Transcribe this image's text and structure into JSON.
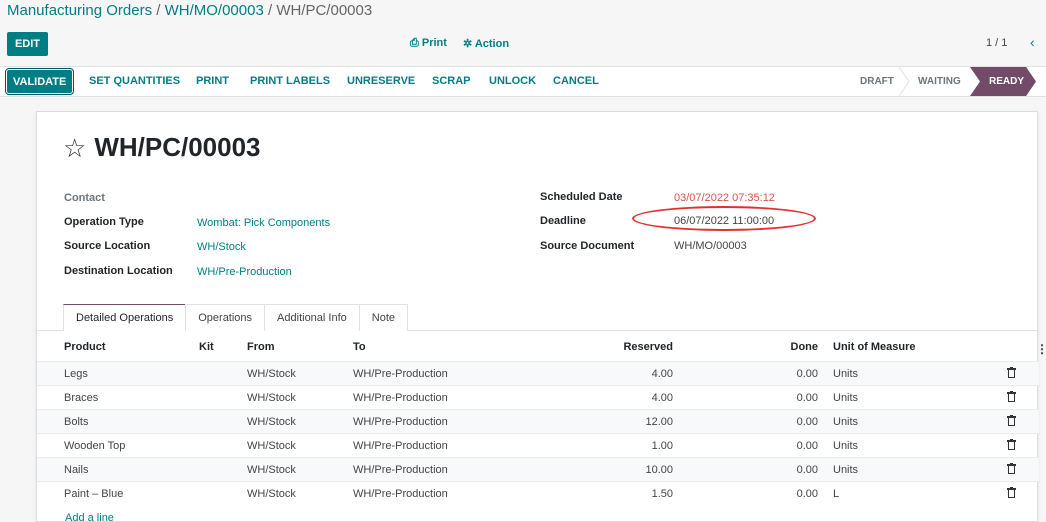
{
  "breadcrumb": {
    "part1": "Manufacturing Orders",
    "sep": " / ",
    "part2": "WH/MO/00003",
    "part3": "WH/PC/00003"
  },
  "control": {
    "edit": "EDIT",
    "print": "Print",
    "action": "Action",
    "pager": "1 / 1",
    "print_icon": "printer-icon",
    "action_icon": "gear-icon"
  },
  "statusbar": {
    "buttons": [
      "VALIDATE",
      "SET QUANTITIES",
      "PRINT",
      "PRINT LABELS",
      "UNRESERVE",
      "SCRAP",
      "UNLOCK",
      "CANCEL"
    ],
    "stages": [
      "DRAFT",
      "WAITING",
      "READY"
    ],
    "active_stage": "READY"
  },
  "record": {
    "title": "WH/PC/00003",
    "left_fields": [
      {
        "label": "Contact",
        "value": ""
      },
      {
        "label": "Operation Type",
        "value": "Wombat: Pick Components"
      },
      {
        "label": "Source Location",
        "value": "WH/Stock"
      },
      {
        "label": "Destination Location",
        "value": "WH/Pre-Production"
      }
    ],
    "right_fields": [
      {
        "label": "Scheduled Date",
        "value": "03/07/2022 07:35:12"
      },
      {
        "label": "Deadline",
        "value": "06/07/2022 11:00:00"
      },
      {
        "label": "Source Document",
        "value": "WH/MO/00003"
      }
    ]
  },
  "tabs": [
    "Detailed Operations",
    "Operations",
    "Additional Info",
    "Note"
  ],
  "table": {
    "headers": [
      "Product",
      "Kit",
      "From",
      "To",
      "Reserved",
      "Done",
      "Unit of Measure"
    ],
    "rows": [
      {
        "product": "Legs",
        "from": "WH/Stock",
        "to": "WH/Pre-Production",
        "reserved": "4.00",
        "done": "0.00",
        "uom": "Units"
      },
      {
        "product": "Braces",
        "from": "WH/Stock",
        "to": "WH/Pre-Production",
        "reserved": "4.00",
        "done": "0.00",
        "uom": "Units"
      },
      {
        "product": "Bolts",
        "from": "WH/Stock",
        "to": "WH/Pre-Production",
        "reserved": "12.00",
        "done": "0.00",
        "uom": "Units"
      },
      {
        "product": "Wooden Top",
        "from": "WH/Stock",
        "to": "WH/Pre-Production",
        "reserved": "1.00",
        "done": "0.00",
        "uom": "Units"
      },
      {
        "product": "Nails",
        "from": "WH/Stock",
        "to": "WH/Pre-Production",
        "reserved": "10.00",
        "done": "0.00",
        "uom": "Units"
      },
      {
        "product": "Paint – Blue",
        "from": "WH/Stock",
        "to": "WH/Pre-Production",
        "reserved": "1.50",
        "done": "0.00",
        "uom": "L"
      }
    ],
    "add_line": "Add a line"
  },
  "colors": {
    "primary": "#017e84",
    "stage_active": "#714b67",
    "overdue": "#d9534f",
    "annotation": "#e0312e"
  }
}
